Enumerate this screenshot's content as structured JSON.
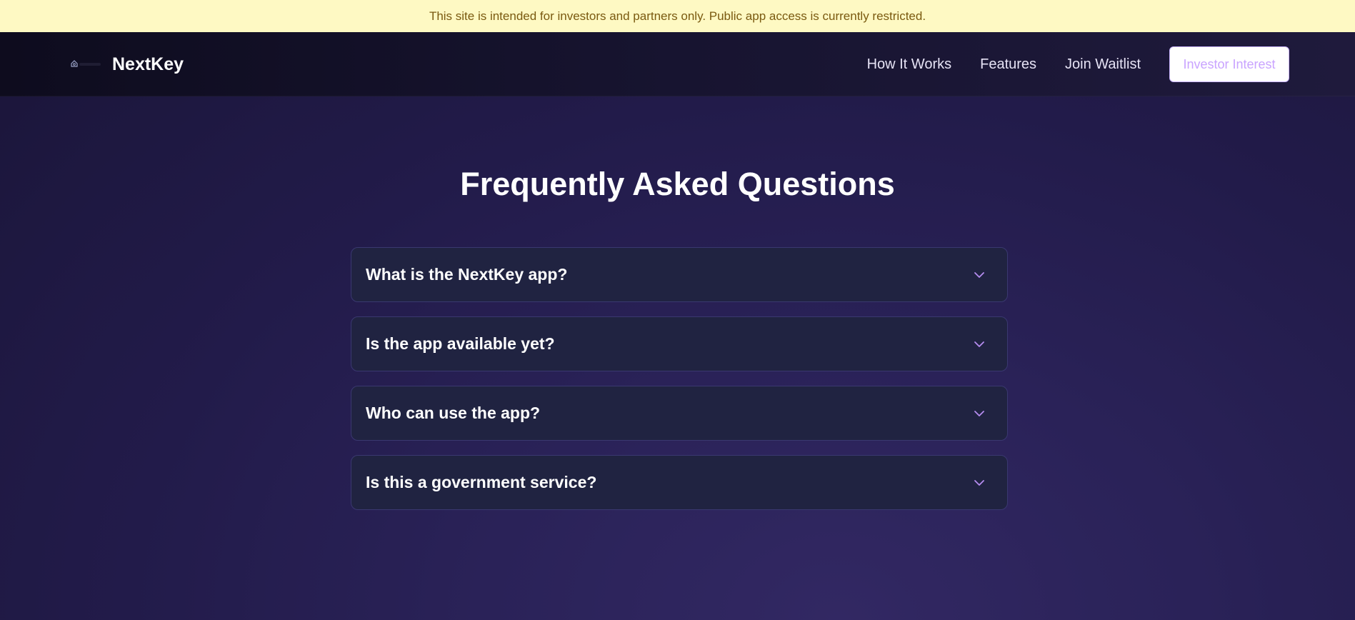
{
  "notice": {
    "text": "This site is intended for investors and partners only. Public app access is currently restricted."
  },
  "header": {
    "brand_name": "NextKey",
    "logo_icon": "house-key-icon",
    "nav": [
      {
        "label": "How It Works"
      },
      {
        "label": "Features"
      },
      {
        "label": "Join Waitlist"
      }
    ],
    "cta_label": "Investor Interest"
  },
  "faq": {
    "title": "Frequently Asked Questions",
    "items": [
      {
        "question": "What is the NextKey app?"
      },
      {
        "question": "Is the app available yet?"
      },
      {
        "question": "Who can use the app?"
      },
      {
        "question": "Is this a government service?"
      }
    ],
    "chevron_icon": "chevron-down-icon"
  },
  "colors": {
    "notice_bg": "#fef9c3",
    "notice_text": "#7a5a10",
    "accent": "#c9a3ff",
    "card_bg": "#202341",
    "card_border": "#3a3870"
  }
}
